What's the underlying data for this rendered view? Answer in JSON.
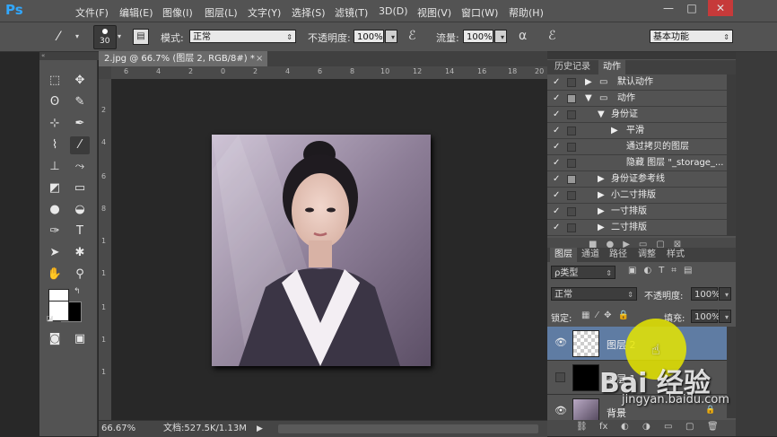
{
  "menubar": {
    "logo": "Ps",
    "items": [
      "文件(F)",
      "编辑(E)",
      "图像(I)",
      "图层(L)",
      "文字(Y)",
      "选择(S)",
      "滤镜(T)",
      "3D(D)",
      "视图(V)",
      "窗口(W)",
      "帮助(H)"
    ],
    "window_controls": [
      "—",
      "□",
      "✕"
    ]
  },
  "options": {
    "brush_size": "30",
    "mode_label": "模式:",
    "mode_value": "正常",
    "opacity_label": "不透明度:",
    "opacity_value": "100%",
    "flow_label": "流量:",
    "flow_value": "100%",
    "workspace": "基本功能"
  },
  "document": {
    "tab_title": "2.jpg @ 66.7% (图层 2, RGB/8#) *",
    "tab_close": "×",
    "ruler_top": [
      "6",
      "4",
      "2",
      "0",
      "2",
      "4",
      "6",
      "8",
      "10",
      "12",
      "14",
      "16",
      "18",
      "20"
    ],
    "ruler_left": [
      "2",
      "4",
      "6",
      "8",
      "1",
      "1",
      "1",
      "1",
      "1"
    ],
    "zoom": "66.67%",
    "doc_info": "文档:527.5K/1.13M"
  },
  "history_panel": {
    "tabs": [
      "历史记录",
      "动作"
    ],
    "actions": [
      {
        "label": "默认动作",
        "indent": 0,
        "expand": "▶",
        "folder": true
      },
      {
        "label": "动作",
        "indent": 0,
        "expand": "▼",
        "folder": true
      },
      {
        "label": "身份证",
        "indent": 1,
        "expand": "▼",
        "folder": false
      },
      {
        "label": "平滑",
        "indent": 2,
        "expand": "▶",
        "folder": false
      },
      {
        "label": "通过拷贝的图层",
        "indent": 3,
        "expand": "",
        "folder": false
      },
      {
        "label": "隐藏 图层 \"_storage_...",
        "indent": 3,
        "expand": "",
        "folder": false
      },
      {
        "label": "身份证参考线",
        "indent": 1,
        "expand": "▶",
        "folder": false
      },
      {
        "label": "小二寸排版",
        "indent": 1,
        "expand": "▶",
        "folder": false
      },
      {
        "label": "一寸排版",
        "indent": 1,
        "expand": "▶",
        "folder": false
      },
      {
        "label": "二寸排版",
        "indent": 1,
        "expand": "▶",
        "folder": false
      }
    ]
  },
  "layers_panel": {
    "tabs": [
      "图层",
      "通道",
      "路径",
      "调整",
      "样式"
    ],
    "filter_label": "ρ类型",
    "blend_mode": "正常",
    "opacity_label": "不透明度:",
    "opacity_value": "100%",
    "lock_label": "锁定:",
    "fill_label": "填充:",
    "fill_value": "100%",
    "layers": [
      {
        "name": "图层 2",
        "visible": true,
        "selected": true
      },
      {
        "name": "图层 1",
        "visible": false,
        "selected": false
      },
      {
        "name": "背景",
        "visible": true,
        "selected": false
      }
    ],
    "bottom_icons": [
      "⛓",
      "fx",
      "◐",
      "◑",
      "▭",
      "▢",
      "🗑"
    ]
  },
  "watermark": {
    "logo_text": "Bai 经验",
    "url": "jingyan.baidu.com"
  },
  "colors": {
    "accent": "#31a8ff",
    "selected_layer": "#5f7ca3",
    "panel_bg": "#535353",
    "canvas_bg": "#282828"
  }
}
